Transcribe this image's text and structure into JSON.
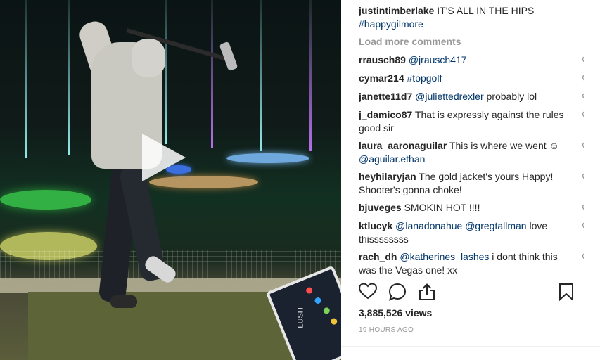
{
  "post": {
    "author": "justintimberlake",
    "caption_text": "IT'S ALL IN THE HIPS",
    "caption_tag": "#happygilmore"
  },
  "load_more_label": "Load more comments",
  "comments": [
    {
      "user": "rrausch89",
      "parts": [
        {
          "t": "@jrausch417",
          "m": true
        }
      ]
    },
    {
      "user": "cymar214",
      "parts": [
        {
          "t": "#topgolf",
          "m": true
        }
      ]
    },
    {
      "user": "janette11d7",
      "parts": [
        {
          "t": "@juliettedrexler",
          "m": true
        },
        {
          "t": " probably lol",
          "m": false
        }
      ]
    },
    {
      "user": "j_damico87",
      "parts": [
        {
          "t": "That is expressly against the rules good sir",
          "m": false
        }
      ]
    },
    {
      "user": "laura_aaronaguilar",
      "parts": [
        {
          "t": "This is where we went ☺ ",
          "m": false
        },
        {
          "t": "@aguilar.ethan",
          "m": true
        }
      ]
    },
    {
      "user": "heyhilaryjan",
      "parts": [
        {
          "t": "The gold jacket's yours Happy! Shooter's gonna choke!",
          "m": false
        }
      ]
    },
    {
      "user": "bjuveges",
      "parts": [
        {
          "t": "SMOKIN HOT !!!!",
          "m": false
        }
      ]
    },
    {
      "user": "ktlucyk",
      "parts": [
        {
          "t": "@lanadonahue",
          "m": true
        },
        {
          "t": " ",
          "m": false
        },
        {
          "t": "@gregtallman",
          "m": true
        },
        {
          "t": " love thissssssss",
          "m": false
        }
      ]
    },
    {
      "user": "rach_dh",
      "parts": [
        {
          "t": "@katherines_lashes",
          "m": true
        },
        {
          "t": " i dont think this was the Vegas one! xx",
          "m": false
        }
      ]
    }
  ],
  "stats": {
    "views": "3,885,526 views",
    "time": "19 HOURS AGO"
  },
  "video": {
    "tablet_label": "LUSH"
  },
  "icons": [
    "heart-icon",
    "comment-icon",
    "share-icon",
    "bookmark-icon",
    "play-icon"
  ],
  "colors": {
    "mention": "#003569",
    "muted": "#999999",
    "text": "#262626"
  }
}
